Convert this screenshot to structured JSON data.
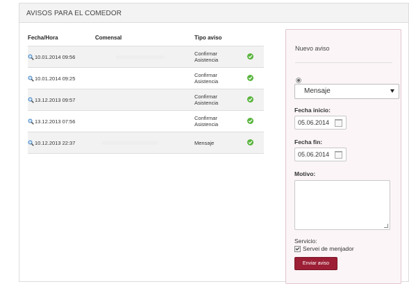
{
  "panel": {
    "title": "AVISOS PARA EL COMEDOR"
  },
  "table": {
    "headers": {
      "fecha": "Fecha/Hora",
      "comensal": "Comensal",
      "tipo": "Tipo aviso"
    },
    "rows": [
      {
        "fecha": "10.01.2014 09:56",
        "tipo_line1": "Confirmar",
        "tipo_line2": "Asistencia"
      },
      {
        "fecha": "10.01.2014 09:25",
        "tipo_line1": "Confirmar",
        "tipo_line2": "Asistencia"
      },
      {
        "fecha": "13.12.2013 09:57",
        "tipo_line1": "Confirmar",
        "tipo_line2": "Asistencia"
      },
      {
        "fecha": "13.12.2013 07:56",
        "tipo_line1": "Confirmar",
        "tipo_line2": "Asistencia"
      },
      {
        "fecha": "10.12.2013 22:37",
        "tipo_line1": "Mensaje",
        "tipo_line2": ""
      }
    ]
  },
  "form": {
    "title": "Nuevo aviso",
    "select_value": "Mensaje",
    "fecha_inicio_label": "Fecha inicio:",
    "fecha_inicio_value": "05.06.2014",
    "fecha_fin_label": "Fecha fin:",
    "fecha_fin_value": "05.06.2014",
    "motivo_label": "Motivo:",
    "servicio_label": "Servicio:",
    "servicio_option": "Servei de menjador",
    "send_label": "Enviar aviso"
  },
  "colors": {
    "accent": "#9c1f35",
    "status_ok": "#58b43c",
    "side_border": "#e2c4cf"
  },
  "icons": {
    "row": "magnifier-icon",
    "status": "check-circle-icon",
    "calendar": "calendar-icon"
  }
}
